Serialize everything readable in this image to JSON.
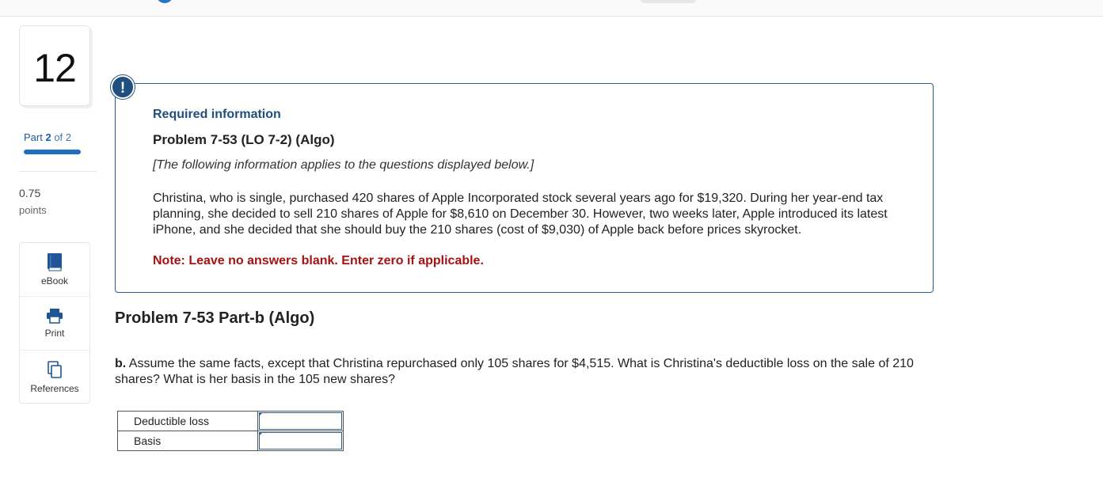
{
  "question": {
    "number": "12",
    "part_label": "Part",
    "part_current": "2",
    "part_of": "of 2",
    "progress_fraction": 1.0,
    "points_value": "0.75",
    "points_label": "points"
  },
  "tools": {
    "ebook_label": "eBook",
    "print_label": "Print",
    "references_label": "References"
  },
  "info_box": {
    "alert_glyph": "!",
    "required_info": "Required information",
    "problem_title": "Problem 7-53 (LO 7-2) (Algo)",
    "following_text": "[The following information applies to the questions displayed below.]",
    "scenario_text": "Christina, who is single, purchased 420 shares of Apple Incorporated stock several years ago for $19,320. During her year-end tax planning, she decided to sell 210 shares of Apple for $8,610 on December 30. However, two weeks later, Apple introduced its latest iPhone, and she decided that she should buy the 210 shares (cost of $9,030) of Apple back before prices skyrocket.",
    "note_text": "Note: Leave no answers blank. Enter zero if applicable."
  },
  "part_b": {
    "heading": "Problem 7-53 Part-b (Algo)",
    "question_prefix": "b.",
    "question_text": " Assume the same facts, except that Christina repurchased only 105 shares for $4,515. What is Christina's deductible loss on the sale of 210 shares? What is her basis in the 105 new shares?"
  },
  "answer_table": {
    "rows": [
      {
        "label": "Deductible loss",
        "value": ""
      },
      {
        "label": "Basis",
        "value": ""
      }
    ]
  },
  "colors": {
    "accent": "#1f4f7f",
    "progress": "#1f70c1",
    "note_red": "#a31313",
    "topbar_dot": "#2a74c5"
  },
  "icons": [
    "ebook-icon",
    "print-icon",
    "references-icon",
    "alert-icon"
  ]
}
